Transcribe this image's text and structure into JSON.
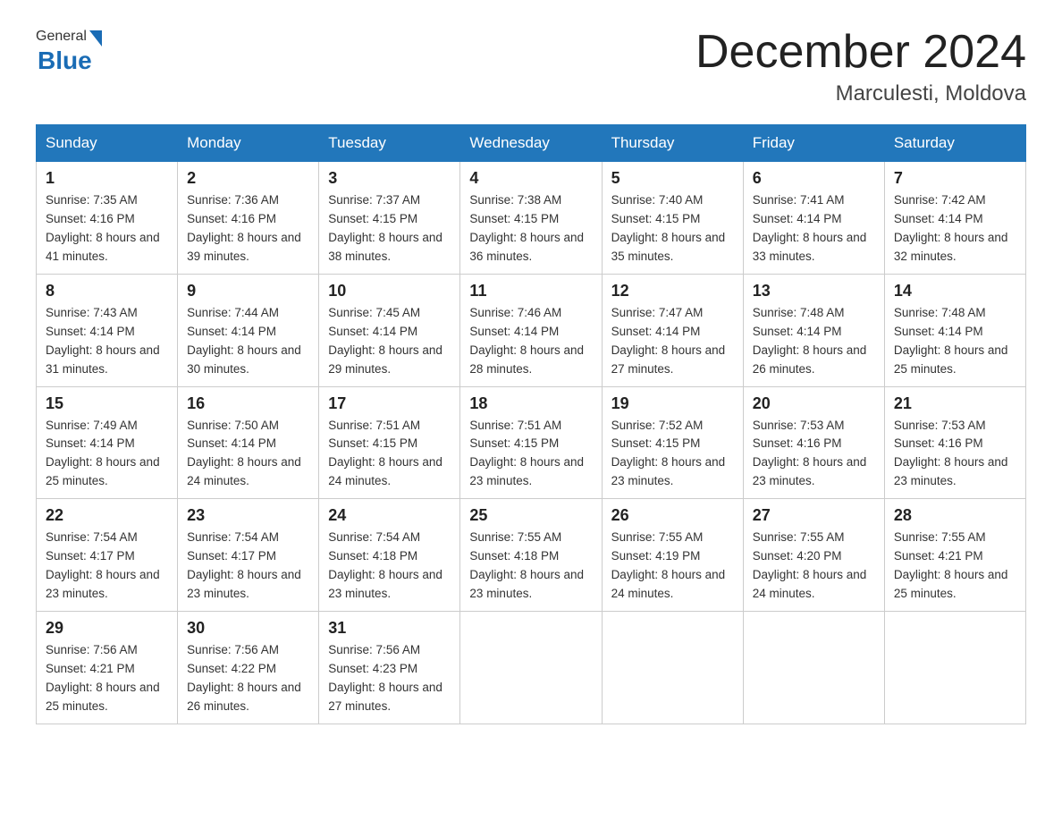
{
  "header": {
    "logo_text_general": "General",
    "logo_text_blue": "Blue",
    "month_year": "December 2024",
    "location": "Marculesti, Moldova"
  },
  "weekdays": [
    "Sunday",
    "Monday",
    "Tuesday",
    "Wednesday",
    "Thursday",
    "Friday",
    "Saturday"
  ],
  "weeks": [
    [
      {
        "day": "1",
        "sunrise": "7:35 AM",
        "sunset": "4:16 PM",
        "daylight": "8 hours and 41 minutes."
      },
      {
        "day": "2",
        "sunrise": "7:36 AM",
        "sunset": "4:16 PM",
        "daylight": "8 hours and 39 minutes."
      },
      {
        "day": "3",
        "sunrise": "7:37 AM",
        "sunset": "4:15 PM",
        "daylight": "8 hours and 38 minutes."
      },
      {
        "day": "4",
        "sunrise": "7:38 AM",
        "sunset": "4:15 PM",
        "daylight": "8 hours and 36 minutes."
      },
      {
        "day": "5",
        "sunrise": "7:40 AM",
        "sunset": "4:15 PM",
        "daylight": "8 hours and 35 minutes."
      },
      {
        "day": "6",
        "sunrise": "7:41 AM",
        "sunset": "4:14 PM",
        "daylight": "8 hours and 33 minutes."
      },
      {
        "day": "7",
        "sunrise": "7:42 AM",
        "sunset": "4:14 PM",
        "daylight": "8 hours and 32 minutes."
      }
    ],
    [
      {
        "day": "8",
        "sunrise": "7:43 AM",
        "sunset": "4:14 PM",
        "daylight": "8 hours and 31 minutes."
      },
      {
        "day": "9",
        "sunrise": "7:44 AM",
        "sunset": "4:14 PM",
        "daylight": "8 hours and 30 minutes."
      },
      {
        "day": "10",
        "sunrise": "7:45 AM",
        "sunset": "4:14 PM",
        "daylight": "8 hours and 29 minutes."
      },
      {
        "day": "11",
        "sunrise": "7:46 AM",
        "sunset": "4:14 PM",
        "daylight": "8 hours and 28 minutes."
      },
      {
        "day": "12",
        "sunrise": "7:47 AM",
        "sunset": "4:14 PM",
        "daylight": "8 hours and 27 minutes."
      },
      {
        "day": "13",
        "sunrise": "7:48 AM",
        "sunset": "4:14 PM",
        "daylight": "8 hours and 26 minutes."
      },
      {
        "day": "14",
        "sunrise": "7:48 AM",
        "sunset": "4:14 PM",
        "daylight": "8 hours and 25 minutes."
      }
    ],
    [
      {
        "day": "15",
        "sunrise": "7:49 AM",
        "sunset": "4:14 PM",
        "daylight": "8 hours and 25 minutes."
      },
      {
        "day": "16",
        "sunrise": "7:50 AM",
        "sunset": "4:14 PM",
        "daylight": "8 hours and 24 minutes."
      },
      {
        "day": "17",
        "sunrise": "7:51 AM",
        "sunset": "4:15 PM",
        "daylight": "8 hours and 24 minutes."
      },
      {
        "day": "18",
        "sunrise": "7:51 AM",
        "sunset": "4:15 PM",
        "daylight": "8 hours and 23 minutes."
      },
      {
        "day": "19",
        "sunrise": "7:52 AM",
        "sunset": "4:15 PM",
        "daylight": "8 hours and 23 minutes."
      },
      {
        "day": "20",
        "sunrise": "7:53 AM",
        "sunset": "4:16 PM",
        "daylight": "8 hours and 23 minutes."
      },
      {
        "day": "21",
        "sunrise": "7:53 AM",
        "sunset": "4:16 PM",
        "daylight": "8 hours and 23 minutes."
      }
    ],
    [
      {
        "day": "22",
        "sunrise": "7:54 AM",
        "sunset": "4:17 PM",
        "daylight": "8 hours and 23 minutes."
      },
      {
        "day": "23",
        "sunrise": "7:54 AM",
        "sunset": "4:17 PM",
        "daylight": "8 hours and 23 minutes."
      },
      {
        "day": "24",
        "sunrise": "7:54 AM",
        "sunset": "4:18 PM",
        "daylight": "8 hours and 23 minutes."
      },
      {
        "day": "25",
        "sunrise": "7:55 AM",
        "sunset": "4:18 PM",
        "daylight": "8 hours and 23 minutes."
      },
      {
        "day": "26",
        "sunrise": "7:55 AM",
        "sunset": "4:19 PM",
        "daylight": "8 hours and 24 minutes."
      },
      {
        "day": "27",
        "sunrise": "7:55 AM",
        "sunset": "4:20 PM",
        "daylight": "8 hours and 24 minutes."
      },
      {
        "day": "28",
        "sunrise": "7:55 AM",
        "sunset": "4:21 PM",
        "daylight": "8 hours and 25 minutes."
      }
    ],
    [
      {
        "day": "29",
        "sunrise": "7:56 AM",
        "sunset": "4:21 PM",
        "daylight": "8 hours and 25 minutes."
      },
      {
        "day": "30",
        "sunrise": "7:56 AM",
        "sunset": "4:22 PM",
        "daylight": "8 hours and 26 minutes."
      },
      {
        "day": "31",
        "sunrise": "7:56 AM",
        "sunset": "4:23 PM",
        "daylight": "8 hours and 27 minutes."
      },
      null,
      null,
      null,
      null
    ]
  ]
}
